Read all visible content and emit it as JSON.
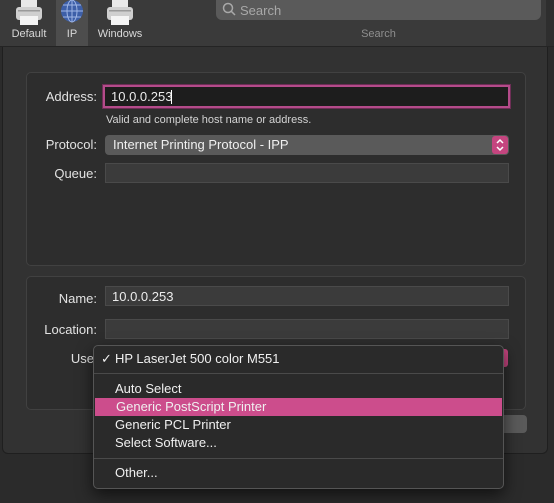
{
  "toolbar": {
    "buttons": [
      {
        "label": "Default"
      },
      {
        "label": "IP"
      },
      {
        "label": "Windows"
      }
    ],
    "search": {
      "placeholder": "Search",
      "label": "Search"
    }
  },
  "form": {
    "address_label": "Address:",
    "address_value": "10.0.0.253",
    "address_hint": "Valid and complete host name or address.",
    "protocol_label": "Protocol:",
    "protocol_value": "Internet Printing Protocol - IPP",
    "queue_label": "Queue:",
    "queue_value": "",
    "name_label": "Name:",
    "name_value": "10.0.0.253",
    "location_label": "Location:",
    "location_value": "",
    "use_label": "Use"
  },
  "use_menu": {
    "selected": "HP LaserJet 500 color M551",
    "items": [
      "Auto Select",
      "Generic PostScript Printer",
      "Generic PCL Printer",
      "Select Software..."
    ],
    "highlighted": "Generic PostScript Printer",
    "other": "Other..."
  },
  "colors": {
    "accent": "#cc4d8c",
    "focus_ring": "#b44b8a"
  }
}
